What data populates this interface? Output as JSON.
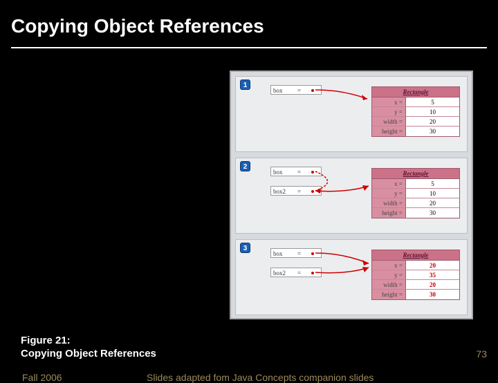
{
  "header": {
    "title": "Copying Object References"
  },
  "caption": {
    "line1": "Figure 21:",
    "line2_a": "Copying",
    "line2_b": " Object References"
  },
  "footer": {
    "date_prefix": "Fall 2006",
    "credits_mid": "Slides adapted",
    "credits_suffix": " fom Java Concepts companion slides",
    "page": "73"
  },
  "diagram": {
    "panels": [
      {
        "num": "1",
        "vars": [
          {
            "name": "box",
            "eq": "="
          }
        ],
        "obj": {
          "type": "Rectangle",
          "fields": [
            {
              "k": "x =",
              "v": "5"
            },
            {
              "k": "y =",
              "v": "10"
            },
            {
              "k": "width =",
              "v": "20"
            },
            {
              "k": "height =",
              "v": "30"
            }
          ]
        }
      },
      {
        "num": "2",
        "vars": [
          {
            "name": "box",
            "eq": "="
          },
          {
            "name": "box2",
            "eq": "="
          }
        ],
        "obj": {
          "type": "Rectangle",
          "fields": [
            {
              "k": "x =",
              "v": "5"
            },
            {
              "k": "y =",
              "v": "10"
            },
            {
              "k": "width =",
              "v": "20"
            },
            {
              "k": "height =",
              "v": "30"
            }
          ]
        }
      },
      {
        "num": "3",
        "vars": [
          {
            "name": "box",
            "eq": "="
          },
          {
            "name": "box2",
            "eq": "="
          }
        ],
        "obj": {
          "type": "Rectangle",
          "fields": [
            {
              "k": "x =",
              "v": "20"
            },
            {
              "k": "y =",
              "v": "35"
            },
            {
              "k": "width =",
              "v": "20"
            },
            {
              "k": "height =",
              "v": "30"
            }
          ]
        }
      }
    ]
  }
}
